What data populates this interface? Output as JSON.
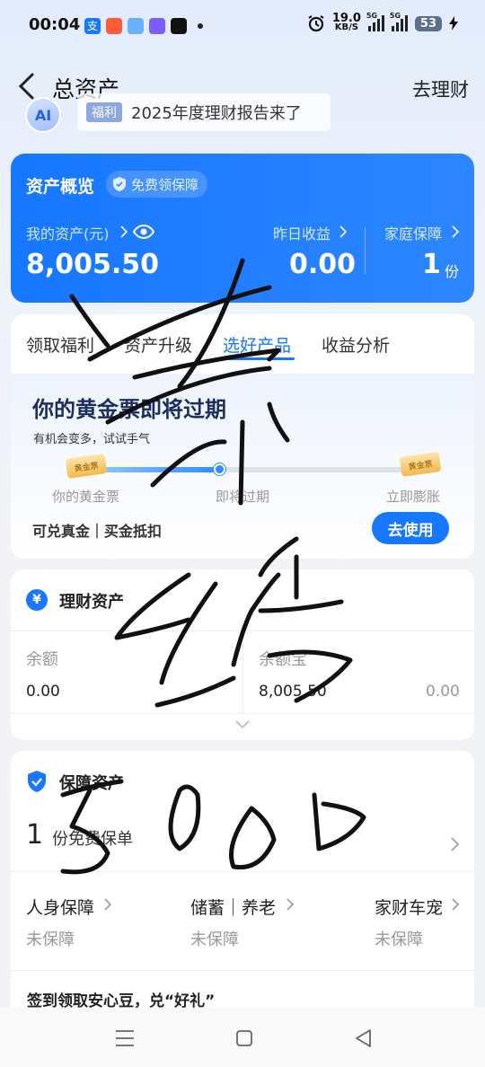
{
  "status": {
    "time": "00:04",
    "net_speed": "19.0",
    "net_unit": "KB/S",
    "sig1": "5G",
    "sig2": "5G",
    "battery": "53"
  },
  "header": {
    "title": "总资产",
    "right_link": "去理财",
    "ai_badge": "AI",
    "banner_tag": "福利",
    "banner_text": "2025年度理财报告来了"
  },
  "assets": {
    "title": "资产概览",
    "protect_pill": "免费领保障",
    "my_assets_label": "我的资产(元)",
    "my_assets_value": "8,005.50",
    "yesterday_label": "昨日收益",
    "yesterday_value": "0.00",
    "family_label": "家庭保障",
    "family_value": "1",
    "family_unit": "份"
  },
  "tabs": {
    "items": [
      "领取福利",
      "资产升级",
      "选好产品",
      "收益分析"
    ],
    "active_index": 2
  },
  "gold": {
    "title": "你的黄金票即将过期",
    "subtitle": "有机会变多，试试手气",
    "ticket_label": "黄金票",
    "steps": [
      "你的黄金票",
      "即将过期",
      "立即膨胀"
    ],
    "exchange": "可兑真金｜买金抵扣",
    "use_button": "去使用"
  },
  "finance": {
    "title": "理财资产",
    "col1_label": "余额",
    "col1_value": "0.00",
    "col2_label": "余额宝",
    "col2_value": "8,005.50",
    "col3_value": "0.00"
  },
  "protect": {
    "title": "保障资产",
    "count": "1",
    "policy_text": "份免费保单",
    "items": [
      {
        "label": "人身保障",
        "value": "未保障"
      },
      {
        "label": "储蓄｜养老",
        "value": "未保障"
      },
      {
        "label": "家财车宠",
        "value": "未保障"
      }
    ],
    "sign_text": "签到领取安心豆，兑“好礼”"
  },
  "colors": {
    "primary": "#1677ff",
    "scribble": "#111111"
  }
}
